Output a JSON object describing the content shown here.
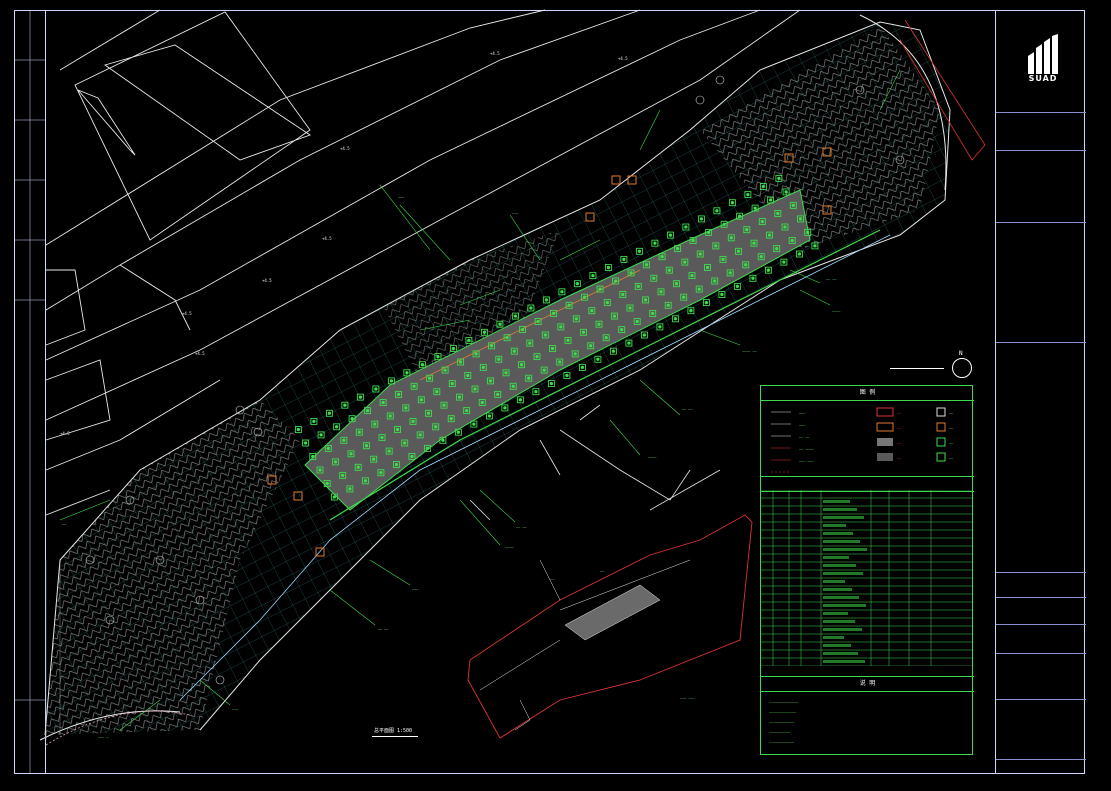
{
  "title_block": {
    "logo_text": "SUAD",
    "rows": [
      "",
      "",
      "",
      "",
      "",
      "",
      "",
      "",
      "",
      "",
      "",
      ""
    ]
  },
  "legend": {
    "header": "图 例",
    "table_header": "",
    "notes_header": "说 明"
  },
  "scale_label": "总平面图 1:500",
  "compass_label": "N",
  "colors": {
    "frame": "#cfd6ff",
    "green": "#3ddc4c",
    "grid": "#2f7c78",
    "red": "#d33",
    "orange": "#e07a2e",
    "white": "#e8e8e8",
    "plaza": "#5a5a5a"
  }
}
